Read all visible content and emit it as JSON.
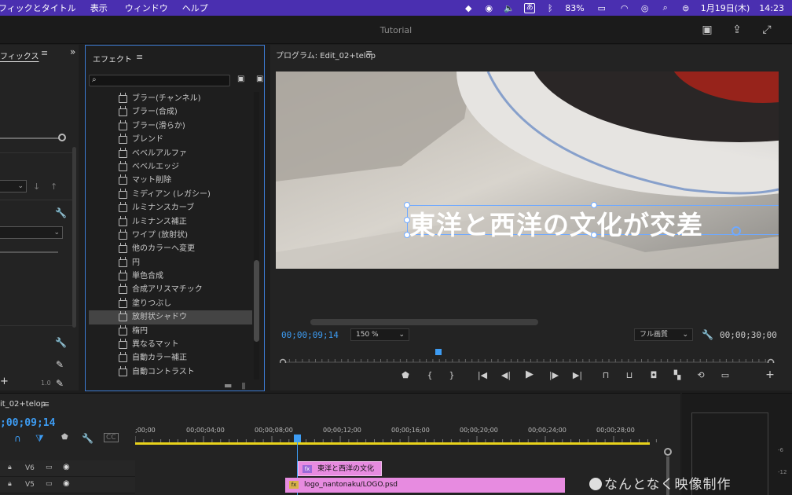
{
  "menubar": {
    "items": [
      "フィックとタイトル",
      "表示",
      "ウィンドウ",
      "ヘルプ"
    ],
    "battery": "83%",
    "ime": "あ",
    "date": "1月19日(木)",
    "time": "14:23"
  },
  "window": {
    "title": "Tutorial"
  },
  "graphics_panel": {
    "title": "フィックス",
    "version": "1.0"
  },
  "effects_panel": {
    "title": "エフェクト",
    "search_placeholder": "",
    "items": [
      "ブラー(チャンネル)",
      "ブラー(合成)",
      "ブラー(滑らか)",
      "ブレンド",
      "ベベルアルファ",
      "ベベルエッジ",
      "マット削除",
      "ミディアン (レガシー)",
      "ルミナンスカーブ",
      "ルミナンス補正",
      "ワイプ (放射状)",
      "他のカラーへ変更",
      "円",
      "単色合成",
      "合成アリスマチック",
      "塗りつぶし",
      "放射状シャドウ",
      "楕円",
      "異なるマット",
      "自動カラー補正",
      "自動コントラスト"
    ],
    "selected_item": "放射状シャドウ"
  },
  "program_monitor": {
    "title": "プログラム: Edit_02+telop",
    "overlay_text": "東洋と西洋の文化が交差",
    "current_timecode": "00;00;09;14",
    "zoom": "150 %",
    "quality": "フル画質",
    "duration": "00;00;30;00",
    "playhead_fraction": 0.315
  },
  "timeline": {
    "title": "it_02+telop",
    "timecode": ";00;09;14",
    "ruler_labels": [
      ";00;00",
      "00;00;04;00",
      "00;00;08;00",
      "00;00;12;00",
      "00;00;16;00",
      "00;00;20;00",
      "00;00;24;00",
      "00;00;28;00"
    ],
    "tracks": [
      {
        "name": "V6",
        "clip": "東洋と西洋の文化"
      },
      {
        "name": "V5",
        "clip": "logo_nantonaku/LOGO.psd"
      }
    ]
  },
  "meters": {
    "scale": [
      "-6",
      "-12"
    ]
  },
  "watermark": "なんとなく映像制作",
  "colors": {
    "accent_blue": "#3d9cf3",
    "clip_pink": "#e78be0",
    "menubar": "#4a2fb0",
    "workarea_yellow": "#e8d21b"
  }
}
